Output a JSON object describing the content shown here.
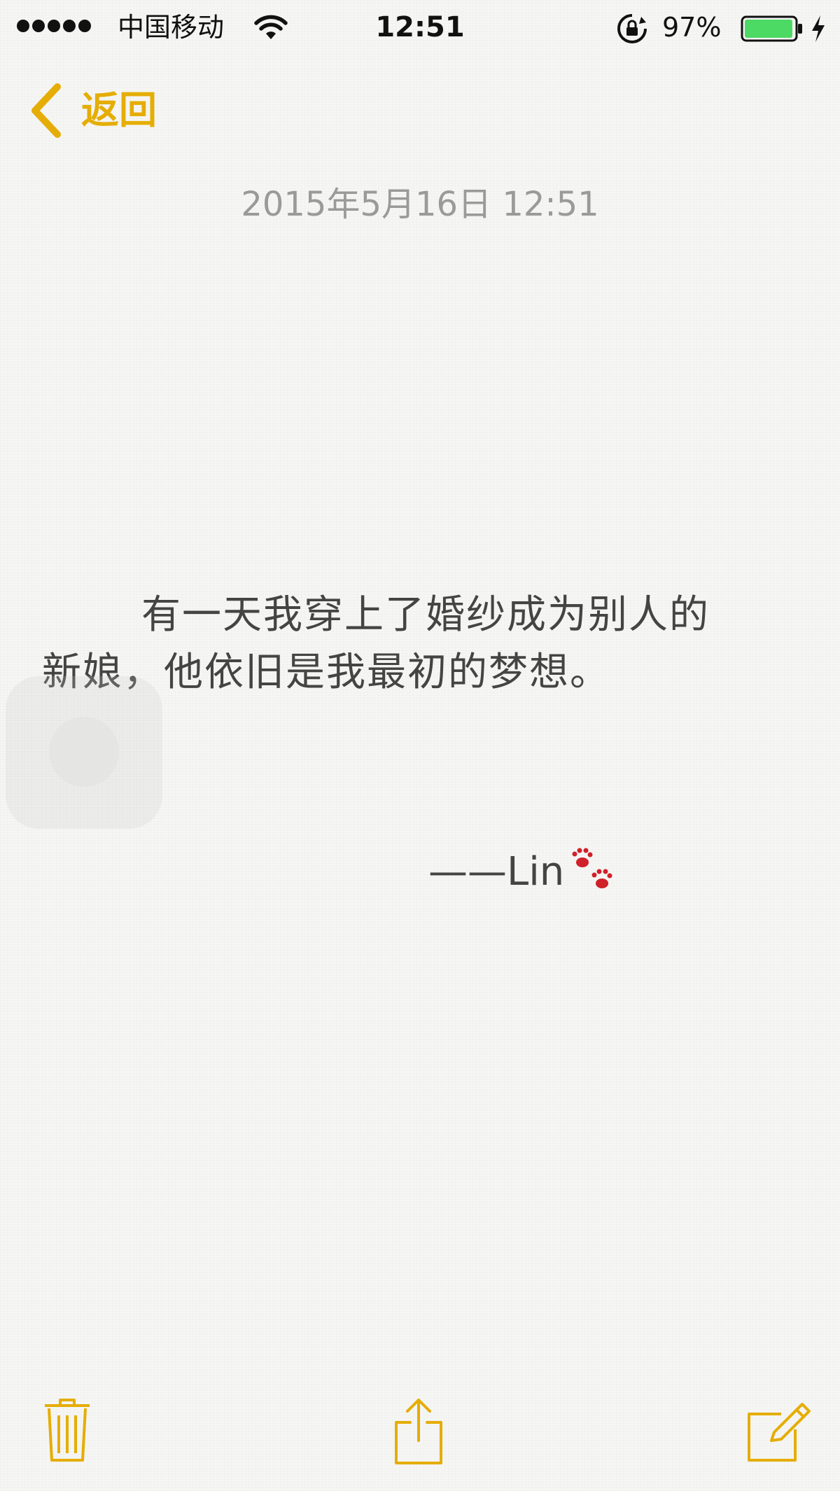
{
  "status_bar": {
    "signal_bars": 5,
    "carrier": "中国移动",
    "time": "12:51",
    "battery_percent": "97%",
    "battery_level": 0.97,
    "icons": [
      "signal-dots",
      "wifi-icon",
      "rotation-lock-icon",
      "battery-icon",
      "charging-bolt-icon"
    ]
  },
  "nav": {
    "back_label": "返回",
    "back_icon": "chevron-left-icon"
  },
  "note": {
    "date": "2015年5月16日 12:51",
    "lines": [
      "有一天我穿上了婚纱成为别人的",
      "新娘，他依旧是我最初的梦想。"
    ],
    "signature": "——Lin",
    "signature_icon": "paw-prints-icon"
  },
  "toolbar": {
    "icons": [
      "trash-icon",
      "share-icon",
      "compose-icon"
    ]
  },
  "colors": {
    "accent": "#e5ad05",
    "date_text": "#9a9a9a",
    "body_text": "#444444",
    "battery_fill": "#4cd964",
    "paw": "#d0202a"
  }
}
